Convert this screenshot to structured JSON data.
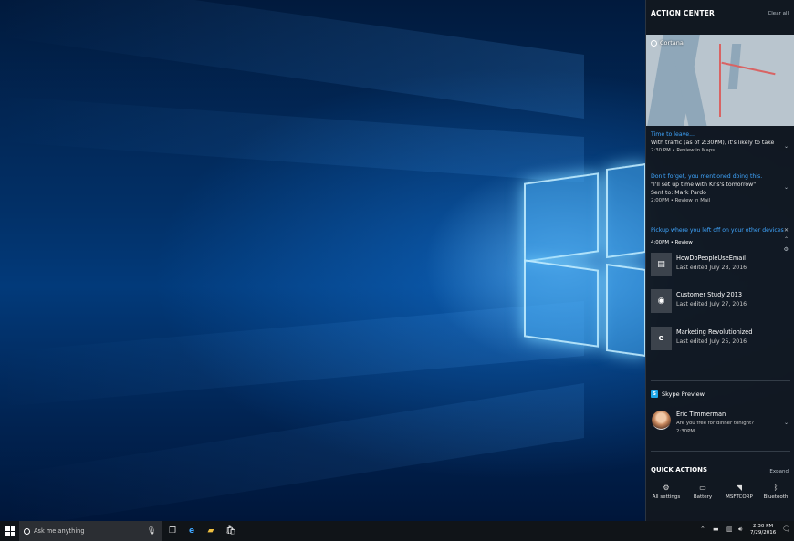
{
  "action_center": {
    "header": "ACTION CENTER",
    "clear_all": "Clear all",
    "cortana_label": "Cortana",
    "notifications": [
      {
        "title": "Time to leave...",
        "body": "With traffic (as of 2:30PM), it's likely to take",
        "meta": "2:30 PM • Review in Maps"
      },
      {
        "title": "Don't forget, you mentioned doing this.",
        "body": "\"I'll set up time with Kris's tomorrow\"",
        "body2": "Sent to: Mark Pardo",
        "meta": "2:00PM • Review in Mail"
      },
      {
        "title": "Pickup where you left off on your other devices",
        "meta": "4:00PM • Review"
      }
    ],
    "documents": [
      {
        "name": "HowDoPeopleUseEmail",
        "date": "Last edited July 28, 2016",
        "icon": "document-icon"
      },
      {
        "name": "Customer Study 2013",
        "date": "Last edited July 27, 2016",
        "icon": "powerpoint-icon"
      },
      {
        "name": "Marketing Revolutionized",
        "date": "Last edited July 25, 2016",
        "icon": "edge-icon"
      }
    ],
    "skype": {
      "app": "Skype Preview",
      "sender": "Eric Timmerman",
      "message": "Are you free for dinner tonight?",
      "time": "2:30PM"
    },
    "quick_actions": {
      "header": "QUICK ACTIONS",
      "expand": "Expand",
      "tiles": [
        {
          "label": "All settings",
          "icon": "gear-icon"
        },
        {
          "label": "Battery",
          "icon": "battery-icon"
        },
        {
          "label": "MSFTCORP",
          "icon": "wifi-icon"
        },
        {
          "label": "Bluetooth",
          "icon": "bluetooth-icon"
        }
      ]
    }
  },
  "taskbar": {
    "search_placeholder": "Ask me anything",
    "time": "2:30 PM",
    "date": "7/29/2016"
  },
  "colors": {
    "accent": "#3fa6ff",
    "panel_bg": "#12181f",
    "taskbar_bg": "#101418"
  }
}
